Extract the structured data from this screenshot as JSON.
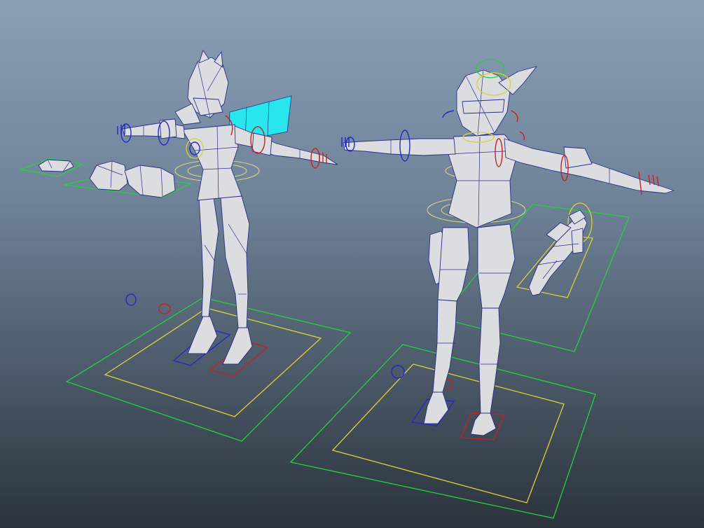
{
  "viewport": {
    "background_top": "#8a9fb6",
    "background_bottom": "#2b333c"
  },
  "scene": {
    "objects": [
      {
        "id": "character-left",
        "kind": "rigged-mesh"
      },
      {
        "id": "character-right",
        "kind": "rigged-mesh"
      },
      {
        "id": "prop-gauntlets",
        "kind": "prop-mesh"
      },
      {
        "id": "prop-rifle",
        "kind": "prop-mesh"
      }
    ],
    "control_colors": {
      "root": "#23d23a",
      "offset": "#d8d234",
      "left_side": "#c42222",
      "right_side": "#2229c8",
      "cape_plane": "#27e6ee"
    }
  }
}
